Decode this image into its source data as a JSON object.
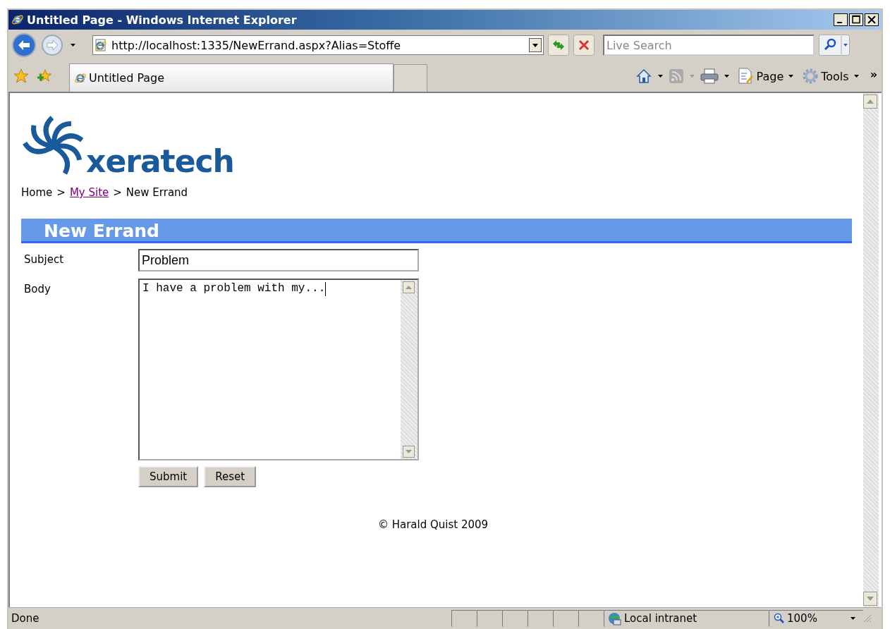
{
  "window": {
    "title": "Untitled Page - Windows Internet Explorer"
  },
  "address_bar": {
    "value": "http://localhost:1335/NewErrand.aspx?Alias=Stoffe"
  },
  "search": {
    "placeholder": "Live Search"
  },
  "tab": {
    "label": "Untitled Page"
  },
  "command_bar": {
    "items": [
      {
        "label": "Page"
      },
      {
        "label": "Tools"
      }
    ],
    "overflow": "»"
  },
  "page": {
    "logo": {
      "text": "xeratech"
    },
    "breadcrumb": {
      "separator": ">",
      "items": [
        {
          "label": "Home",
          "link": false
        },
        {
          "label": "My Site",
          "link": true
        },
        {
          "label": "New Errand",
          "link": false
        }
      ]
    },
    "heading": "New Errand",
    "fields": [
      {
        "label": "Subject",
        "kind": "text",
        "value": "Problem"
      },
      {
        "label": "Body",
        "kind": "textarea",
        "value": "I have a problem with my..."
      }
    ],
    "buttons": [
      "Submit",
      "Reset"
    ],
    "footer": "© Harald Quist 2009"
  },
  "status_bar": {
    "text": "Done",
    "zone": "Local intranet",
    "zoom": "100%"
  }
}
